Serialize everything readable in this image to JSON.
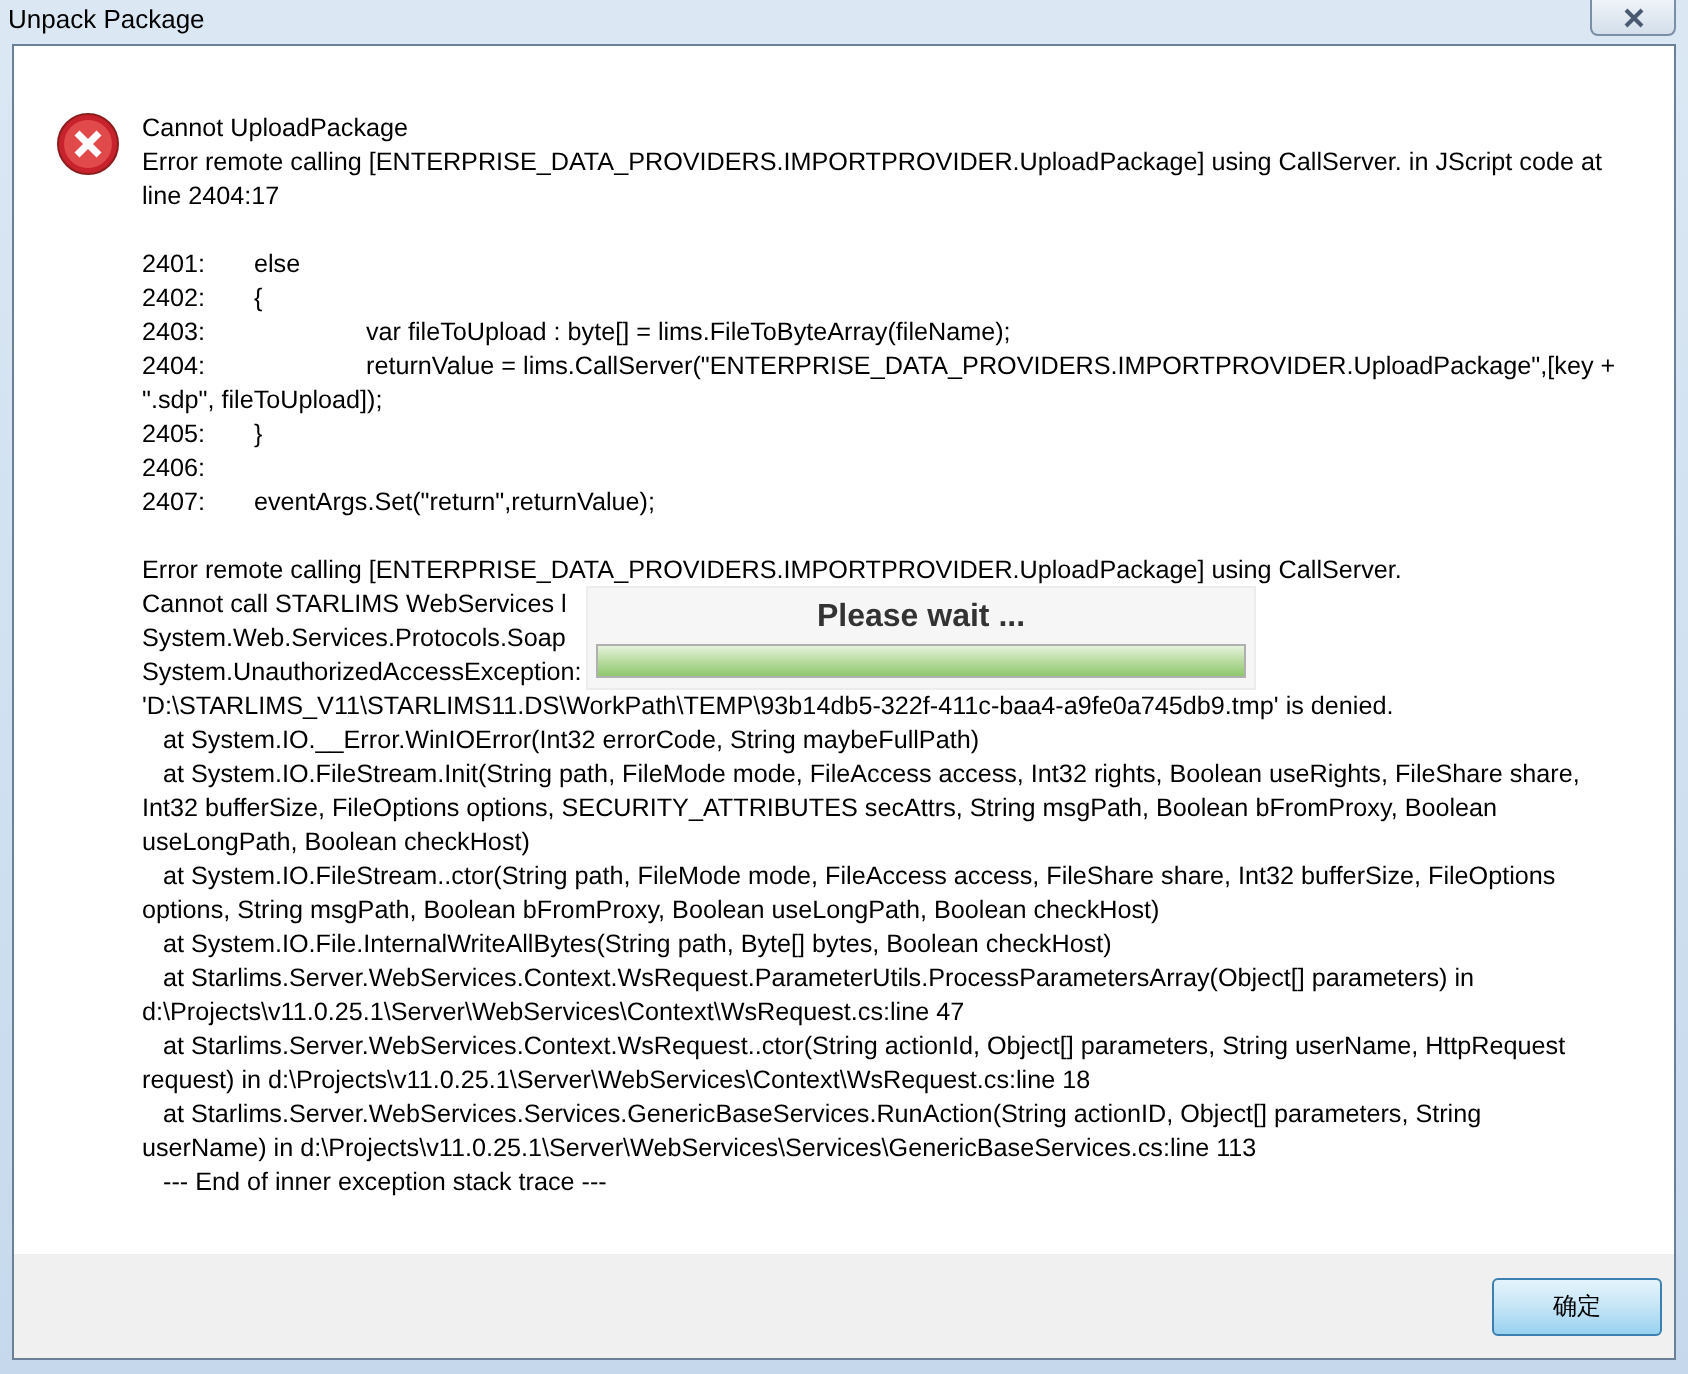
{
  "window": {
    "title": "Unpack Package"
  },
  "message": {
    "title": "Cannot UploadPackage",
    "paragraphs": [
      [
        "Error remote calling [ENTERPRISE_DATA_PROVIDERS.IMPORTPROVIDER.UploadPackage] using CallServer. in JScript code at",
        "line 2404:17"
      ],
      [
        "2401:\telse",
        "2402:\t{",
        "2403:\t\tvar fileToUpload : byte[] = lims.FileToByteArray(fileName);",
        "2404:\t\treturnValue = lims.CallServer(\"ENTERPRISE_DATA_PROVIDERS.IMPORTPROVIDER.UploadPackage\",[key +",
        "\".sdp\", fileToUpload]);",
        "2405:\t}",
        "2406:",
        "2407:\teventArgs.Set(\"return\",returnValue);"
      ],
      [
        "Error remote calling [ENTERPRISE_DATA_PROVIDERS.IMPORTPROVIDER.UploadPackage] using CallServer.",
        "Cannot call STARLIMS WebServices l",
        "System.Web.Services.Protocols.Soap",
        "System.UnauthorizedAccessException:",
        "'D:\\STARLIMS_V11\\STARLIMS11.DS\\WorkPath\\TEMP\\93b14db5-322f-411c-baa4-a9fe0a745db9.tmp' is denied.",
        "   at System.IO.__Error.WinIOError(Int32 errorCode, String maybeFullPath)",
        "   at System.IO.FileStream.Init(String path, FileMode mode, FileAccess access, Int32 rights, Boolean useRights, FileShare share,",
        "Int32 bufferSize, FileOptions options, SECURITY_ATTRIBUTES secAttrs, String msgPath, Boolean bFromProxy, Boolean",
        "useLongPath, Boolean checkHost)",
        "   at System.IO.FileStream..ctor(String path, FileMode mode, FileAccess access, FileShare share, Int32 bufferSize, FileOptions",
        "options, String msgPath, Boolean bFromProxy, Boolean useLongPath, Boolean checkHost)",
        "   at System.IO.File.InternalWriteAllBytes(String path, Byte[] bytes, Boolean checkHost)",
        "   at Starlims.Server.WebServices.Context.WsRequest.ParameterUtils.ProcessParametersArray(Object[] parameters) in",
        "d:\\Projects\\v11.0.25.1\\Server\\WebServices\\Context\\WsRequest.cs:line 47",
        "   at Starlims.Server.WebServices.Context.WsRequest..ctor(String actionId, Object[] parameters, String userName, HttpRequest",
        "request) in d:\\Projects\\v11.0.25.1\\Server\\WebServices\\Context\\WsRequest.cs:line 18",
        "   at Starlims.Server.WebServices.Services.GenericBaseServices.RunAction(String actionID, Object[] parameters, String",
        "userName) in d:\\Projects\\v11.0.25.1\\Server\\WebServices\\Services\\GenericBaseServices.cs:line 113",
        "   --- End of inner exception stack trace ---"
      ]
    ]
  },
  "progress": {
    "label": "Please wait ...",
    "level": 1
  },
  "buttons": [
    "确定"
  ]
}
